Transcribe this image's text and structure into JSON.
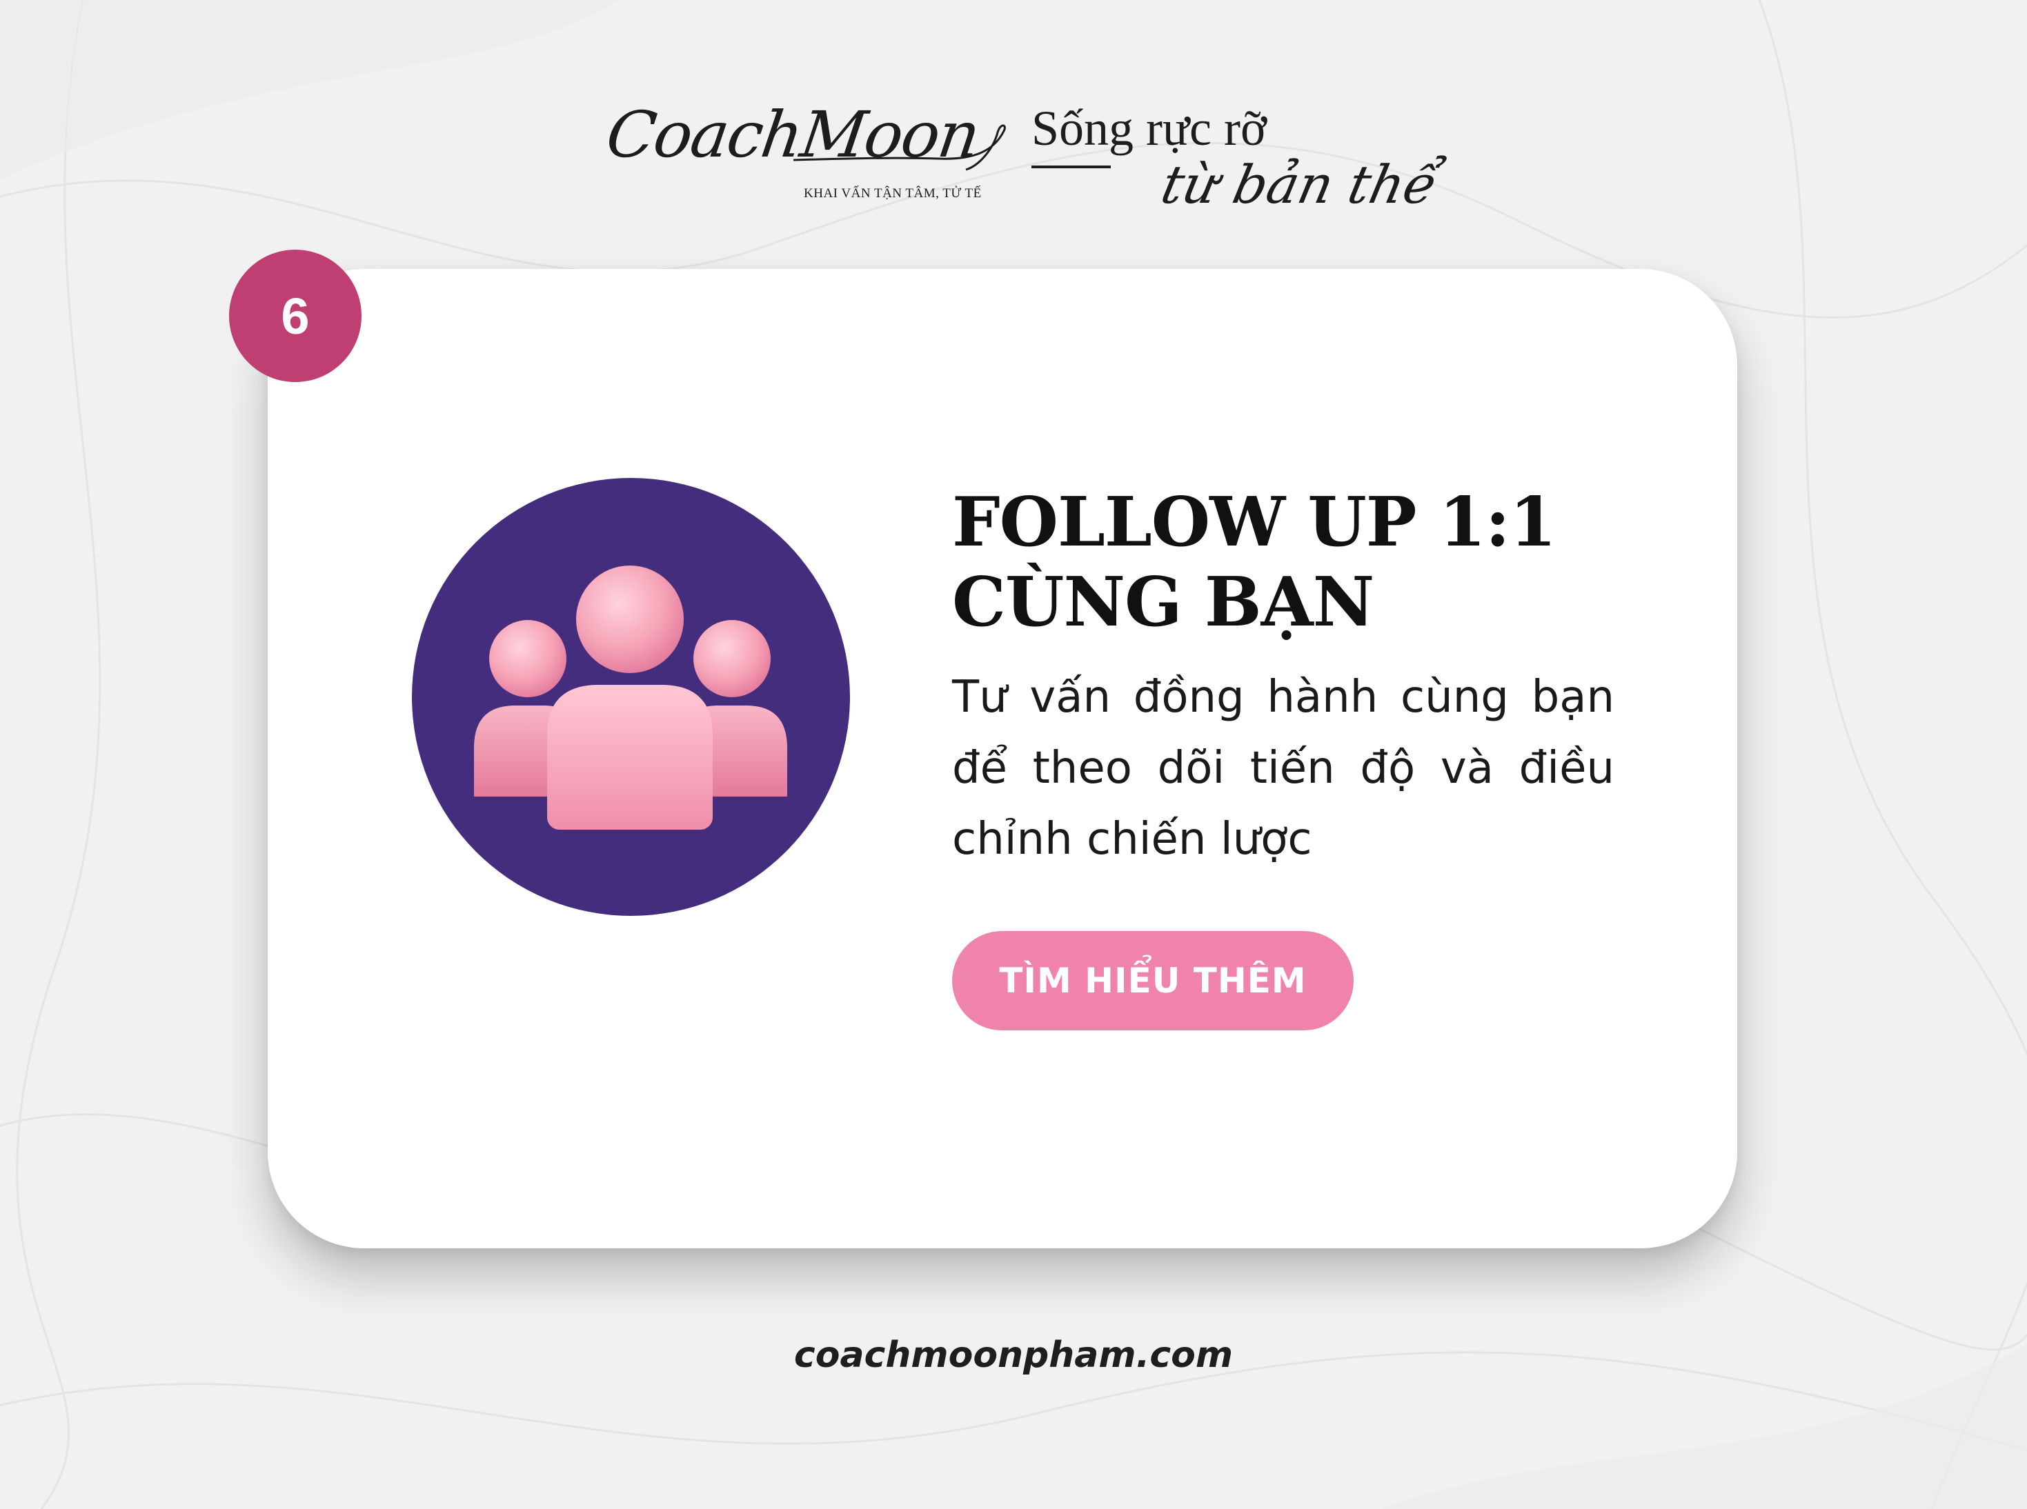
{
  "header": {
    "brand_script": "CoachMoon",
    "brand_tagline": "KHAI VẤN TẬN TÂM, TỬ TẾ",
    "slogan_line1": "Sống rực rỡ",
    "slogan_line2": "từ bản thể"
  },
  "card": {
    "step_number": "6",
    "icon": "group-of-people-icon",
    "title_line1": "FOLLOW UP 1:1",
    "title_line2": "CÙNG BẠN",
    "description": "Tư vấn đồng hành cùng bạn để theo dõi tiến độ và điều chỉnh chiến lược",
    "cta_label": "TÌM HIỂU THÊM"
  },
  "footer": {
    "url": "coachmoonpham.com"
  },
  "colors": {
    "background": "#f1f1f2",
    "badge": "#bf3f73",
    "icon_circle": "#432d7c",
    "cta": "#ef83ab",
    "people_pink": "#f4a6b8"
  }
}
